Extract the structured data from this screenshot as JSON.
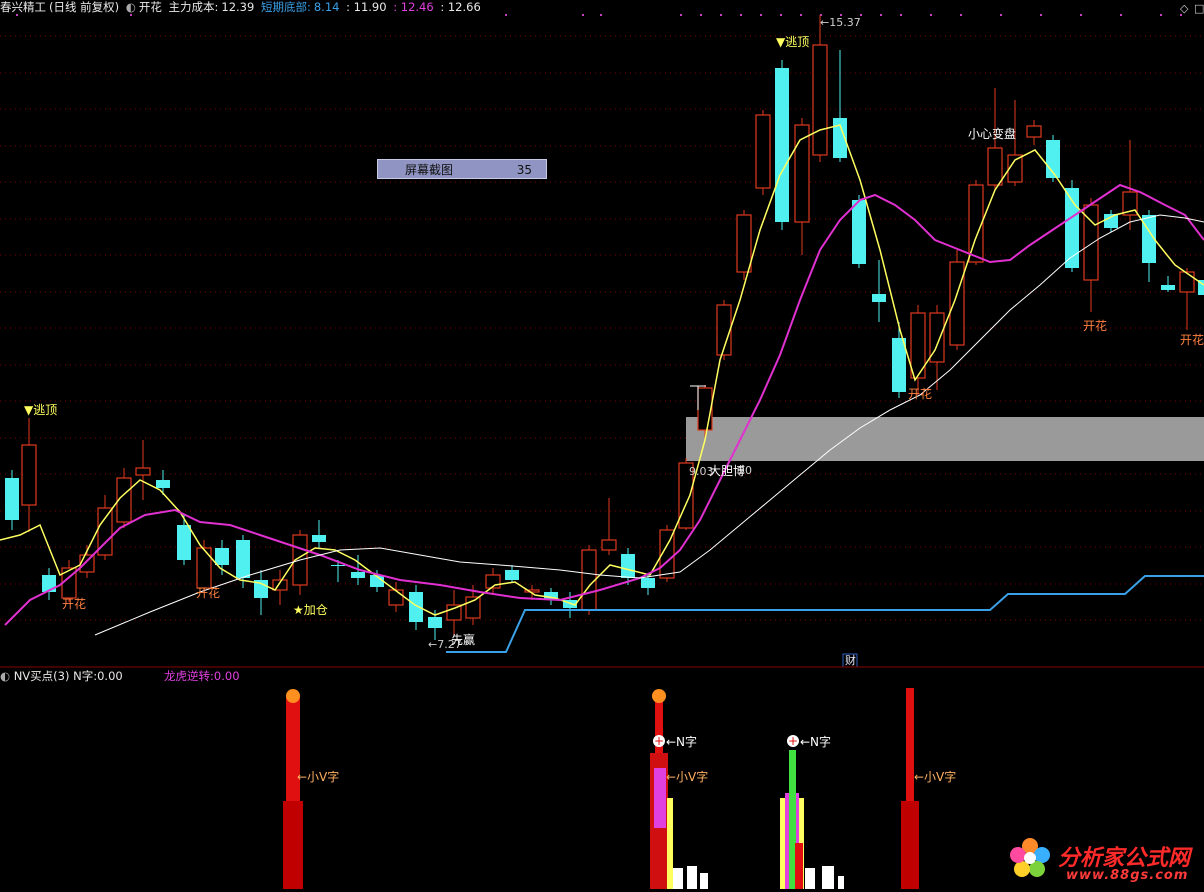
{
  "header": {
    "app": "春兴精工",
    "mode": "(日线 前复权)",
    "indicator": "开花",
    "main_cost_label": "主力成本:",
    "main_cost_value": "12.39",
    "short_bottom_label": "短期底部:",
    "short_bottom_value": "8.14",
    "val3": ": 11.90",
    "val4": ": 12.46",
    "val5": ": 12.66"
  },
  "popup": {
    "label": "屏幕截图",
    "value": "35"
  },
  "chart_data": {
    "type": "candlestick",
    "high_label": "15.37",
    "low_label": "7.27",
    "price_label": "9.03",
    "price_label2": "20",
    "annotations": [
      "逃顶",
      "逃顶",
      "开花",
      "开花",
      "加仓",
      "先赢",
      "大胆博",
      "开花",
      "小心变盘",
      "开花",
      "开花",
      "财"
    ]
  },
  "sub": {
    "title": "NV买点(3)",
    "n_label": "N字:",
    "n_value": "0.00",
    "dragon_label": "龙虎逆转:",
    "dragon_value": "0.00",
    "markers": [
      "小V字",
      "N字",
      "小V字",
      "N字",
      "小V字"
    ]
  },
  "watermark": {
    "text": "分析家公式网",
    "url": "www.88gs.com"
  },
  "colors": {
    "up": "#e03a1e",
    "down": "#50f0f0",
    "ma_yellow": "#ffff60",
    "ma_magenta": "#e030d0",
    "ma_white": "#ffffff",
    "support": "#3aa0e8"
  }
}
